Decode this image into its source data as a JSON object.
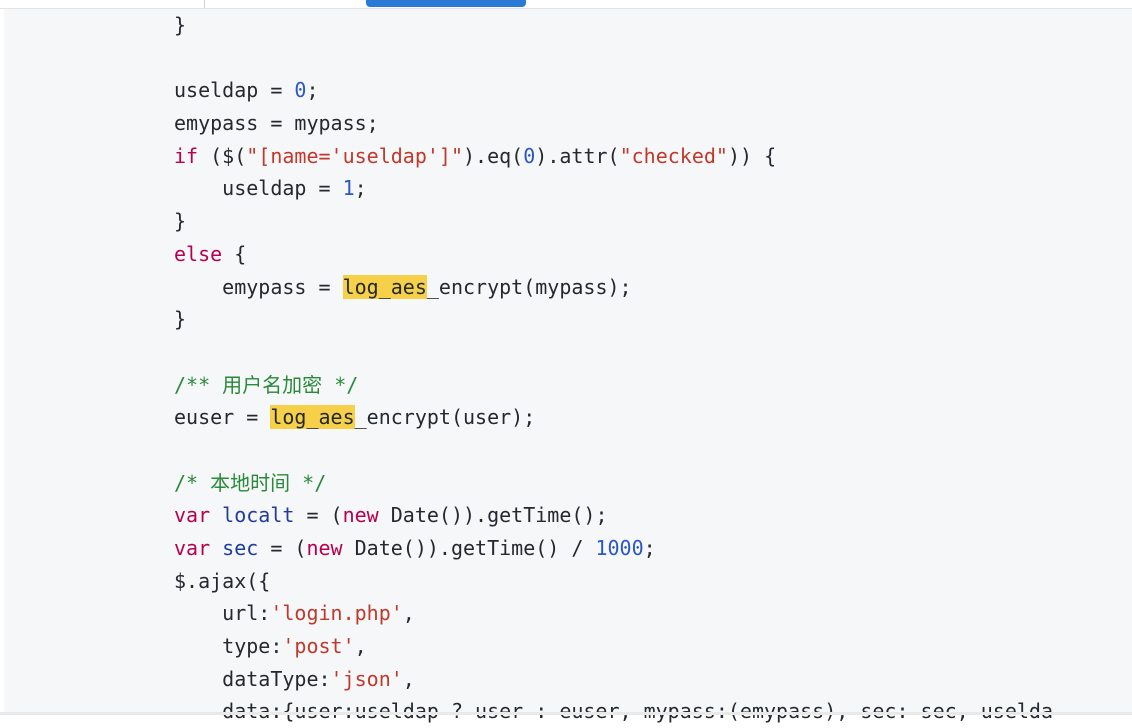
{
  "code_lines": [
    [
      {
        "t": "}"
      }
    ],
    [],
    [
      {
        "t": "useldap = "
      },
      {
        "t": "0",
        "c": "num"
      },
      {
        "t": ";"
      }
    ],
    [
      {
        "t": "emypass = mypass;"
      }
    ],
    [
      {
        "t": "if",
        "c": "kw"
      },
      {
        "t": " ($("
      },
      {
        "t": "\"[name='useldap']\"",
        "c": "str"
      },
      {
        "t": ").eq("
      },
      {
        "t": "0",
        "c": "num"
      },
      {
        "t": ").attr("
      },
      {
        "t": "\"checked\"",
        "c": "str"
      },
      {
        "t": ")) {"
      }
    ],
    [
      {
        "t": "    useldap = "
      },
      {
        "t": "1",
        "c": "num"
      },
      {
        "t": ";"
      }
    ],
    [
      {
        "t": "}"
      }
    ],
    [
      {
        "t": "else",
        "c": "kw"
      },
      {
        "t": " {"
      }
    ],
    [
      {
        "t": "    emypass = "
      },
      {
        "t": "log_aes",
        "c": "hl"
      },
      {
        "t": "_encrypt(mypass);"
      }
    ],
    [
      {
        "t": "}"
      }
    ],
    [],
    [
      {
        "t": "/** 用户名加密 */",
        "c": "com"
      }
    ],
    [
      {
        "t": "euser = "
      },
      {
        "t": "log_aes",
        "c": "hl"
      },
      {
        "t": "_encrypt(user);"
      }
    ],
    [],
    [
      {
        "t": "/* 本地时间 */",
        "c": "com"
      }
    ],
    [
      {
        "t": "var",
        "c": "kw"
      },
      {
        "t": " "
      },
      {
        "t": "localt",
        "c": "def"
      },
      {
        "t": " = ("
      },
      {
        "t": "new",
        "c": "kw"
      },
      {
        "t": " Date()).getTime();"
      }
    ],
    [
      {
        "t": "var",
        "c": "kw"
      },
      {
        "t": " "
      },
      {
        "t": "sec",
        "c": "def"
      },
      {
        "t": " = ("
      },
      {
        "t": "new",
        "c": "kw"
      },
      {
        "t": " Date()).getTime() / "
      },
      {
        "t": "1000",
        "c": "num"
      },
      {
        "t": ";"
      }
    ],
    [
      {
        "t": "$.ajax({"
      }
    ],
    [
      {
        "t": "    url:"
      },
      {
        "t": "'login.php'",
        "c": "str"
      },
      {
        "t": ","
      }
    ],
    [
      {
        "t": "    type:"
      },
      {
        "t": "'post'",
        "c": "str"
      },
      {
        "t": ","
      }
    ],
    [
      {
        "t": "    dataType:"
      },
      {
        "t": "'json'",
        "c": "str"
      },
      {
        "t": ","
      }
    ],
    [
      {
        "t": "    data:{user:useldap ? user : euser, mypass:(emypass), sec: sec, uselda"
      }
    ]
  ]
}
